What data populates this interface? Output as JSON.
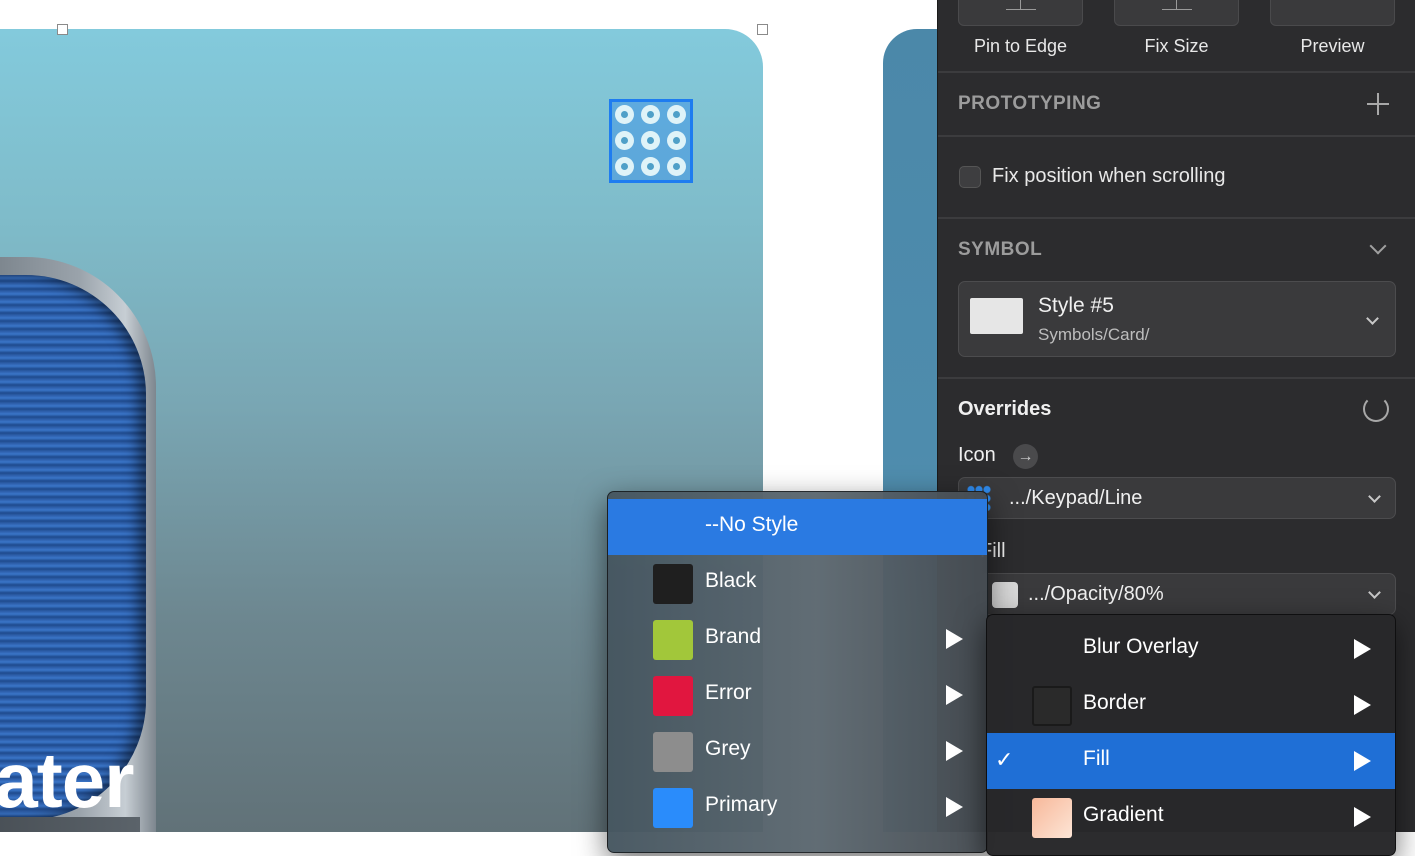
{
  "canvas": {
    "card_title": "eater"
  },
  "inspector": {
    "resizing": {
      "buttons": [
        {
          "label": "Pin to Edge"
        },
        {
          "label": "Fix Size"
        },
        {
          "label": "Preview"
        }
      ]
    },
    "prototyping": {
      "title": "PROTOTYPING",
      "fix_position_label": "Fix position when scrolling"
    },
    "symbol": {
      "title": "SYMBOL",
      "name": "Style #5",
      "path": "Symbols/Card/"
    },
    "overrides": {
      "title": "Overrides",
      "icon_label": "Icon",
      "icon_value": ".../Keypad/Line",
      "fill_label": "Fill",
      "fill_value": ".../Opacity/80%"
    }
  },
  "styles_menu": {
    "items": [
      {
        "label": "--No Style",
        "selected": true
      },
      {
        "label": "Black",
        "color": "#1f1f1f",
        "submenu": false
      },
      {
        "label": "Brand",
        "color": "#a2c73a",
        "submenu": true
      },
      {
        "label": "Error",
        "color": "#e1163f",
        "submenu": true
      },
      {
        "label": "Grey",
        "color": "#8d8d8d",
        "submenu": true
      },
      {
        "label": "Primary",
        "color": "#2a8cfb",
        "submenu": true
      }
    ]
  },
  "sub_menu": {
    "items": [
      {
        "label": "Blur Overlay",
        "checked": false
      },
      {
        "label": "Border",
        "checked": false
      },
      {
        "label": "Fill",
        "checked": true
      },
      {
        "label": "Gradient",
        "checked": false
      }
    ]
  },
  "colors": {
    "accent": "#2a7ae2",
    "selection": "#1e7cf0"
  }
}
